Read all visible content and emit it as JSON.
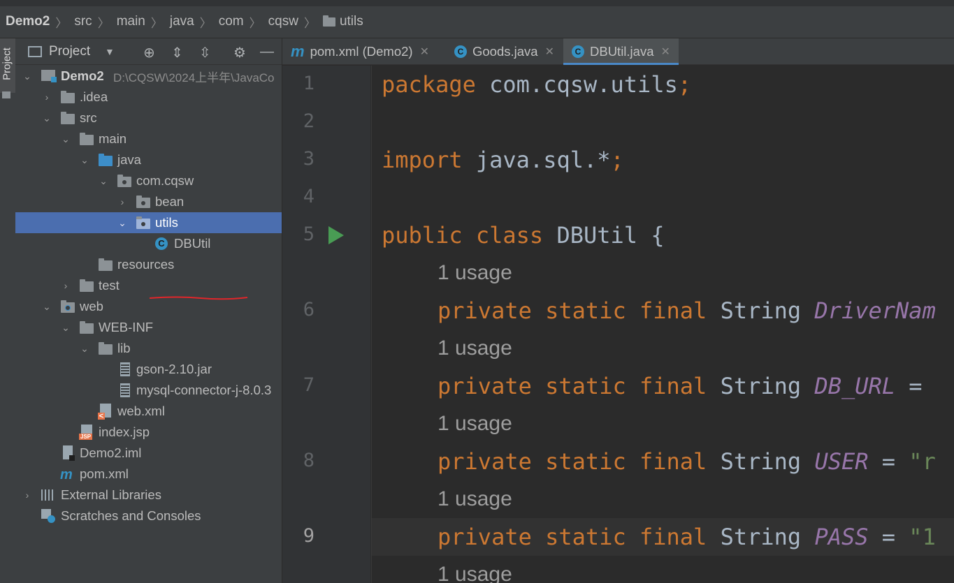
{
  "breadcrumb": [
    "Demo2",
    "src",
    "main",
    "java",
    "com",
    "cqsw",
    "utils"
  ],
  "side_strip": {
    "project_label": "Project"
  },
  "project_panel": {
    "title": "Project",
    "toolbar_icons": [
      "chevron-down-icon",
      "locate-icon",
      "expand-all-icon",
      "collapse-all-icon",
      "gear-icon",
      "minimize-icon"
    ],
    "tree": [
      {
        "label": "Demo2",
        "path": "D:\\CQSW\\2024上半年\\JavaCo"
      },
      {
        "label": ".idea"
      },
      {
        "label": "src"
      },
      {
        "label": "main"
      },
      {
        "label": "java"
      },
      {
        "label": "com.cqsw"
      },
      {
        "label": "bean"
      },
      {
        "label": "utils"
      },
      {
        "label": "DBUtil"
      },
      {
        "label": "resources"
      },
      {
        "label": "test"
      },
      {
        "label": "web"
      },
      {
        "label": "WEB-INF"
      },
      {
        "label": "lib"
      },
      {
        "label": "gson-2.10.jar"
      },
      {
        "label": "mysql-connector-j-8.0.3"
      },
      {
        "label": "web.xml"
      },
      {
        "label": "index.jsp"
      },
      {
        "label": "Demo2.iml"
      },
      {
        "label": "pom.xml"
      },
      {
        "label": "External Libraries"
      },
      {
        "label": "Scratches and Consoles"
      }
    ]
  },
  "editor_tabs": [
    {
      "label": "pom.xml (Demo2)",
      "icon": "maven-icon"
    },
    {
      "label": "Goods.java",
      "icon": "class-icon"
    },
    {
      "label": "DBUtil.java",
      "icon": "class-icon",
      "active": true
    }
  ],
  "gutter": [
    "1",
    "2",
    "3",
    "4",
    "5",
    "6",
    "7",
    "8",
    "9"
  ],
  "code": {
    "l1": {
      "kw": "package",
      "rest": " com.cqsw.utils",
      "semi": ";"
    },
    "l3": {
      "kw": "import",
      "rest": " java.sql.*",
      "semi": ";"
    },
    "l5": {
      "kw1": "public",
      "kw2": " class",
      "rest": " DBUtil {"
    },
    "usage": "1 usage",
    "fields": [
      {
        "mods": "private static final",
        "type": " String ",
        "name": "DriverNam",
        "tail": ""
      },
      {
        "mods": "private static final",
        "type": " String ",
        "name": "DB_URL",
        "tail": " ="
      },
      {
        "mods": "private static final",
        "type": " String ",
        "name": "USER",
        "tail": " = ",
        "str": "\"r"
      },
      {
        "mods": "private static final",
        "type": " String ",
        "name": "PASS",
        "tail": " = ",
        "str": "\"1"
      }
    ]
  }
}
